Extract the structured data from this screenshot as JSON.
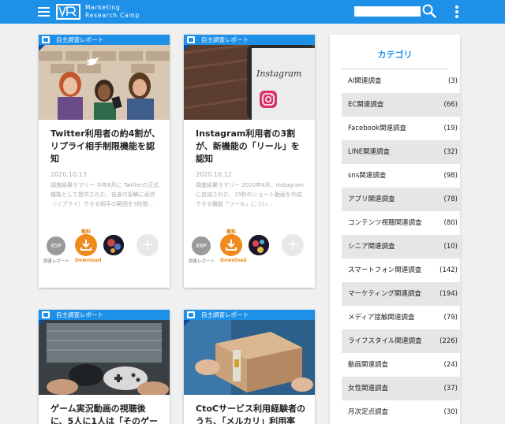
{
  "header": {
    "brand_line1": "Marketing",
    "brand_line2": "Research Camp",
    "search_placeholder": ""
  },
  "label_text": "自主調査レポート",
  "cards": [
    {
      "label": "自主調査レポート",
      "title": "Twitter利用者の約4割が、リプライ相手制限機能を認知",
      "date": "2020.10.13",
      "excerpt": "調査結果サマリー 今年8月に Twitterの正式機能として提供された、自身の投稿に返信（リプライ）できる相手の範囲を3段階…",
      "pages": "85P",
      "pages_caption": "調査レポート",
      "free": "無料",
      "download": "Download"
    },
    {
      "label": "自主調査レポート",
      "title": "Instagram利用者の3割が、新機能の「リール」を認知",
      "date": "2020.10.12",
      "excerpt": "調査結果サマリー 2020年8月、Instagramに追加された、15秒のショート動画を作成できる機能「リール」につい…",
      "pages": "88P",
      "pages_caption": "調査レポート",
      "free": "無料",
      "download": "Download"
    },
    {
      "label": "自主調査レポート",
      "title": "ゲーム実況動画の視聴後に、5人に1人は「そのゲー"
    },
    {
      "label": "自主調査レポート",
      "title": "CtoCサービス利用経験者のうち、「メルカリ」利用率"
    }
  ],
  "sidebar": {
    "title": "カテゴリ",
    "items": [
      {
        "name": "AI関連調査",
        "count": "(3)"
      },
      {
        "name": "EC関連調査",
        "count": "(66)"
      },
      {
        "name": "Facebook関連調査",
        "count": "(19)"
      },
      {
        "name": "LINE関連調査",
        "count": "(32)"
      },
      {
        "name": "sns関連調査",
        "count": "(98)"
      },
      {
        "name": "アプリ関連調査",
        "count": "(78)"
      },
      {
        "name": "コンテンツ視聴関連調査",
        "count": "(80)"
      },
      {
        "name": "シニア関連調査",
        "count": "(10)"
      },
      {
        "name": "スマートフォン関連調査",
        "count": "(142)"
      },
      {
        "name": "マーケティング関連調査",
        "count": "(194)"
      },
      {
        "name": "メディア接触関連調査",
        "count": "(79)"
      },
      {
        "name": "ライフスタイル関連調査",
        "count": "(226)"
      },
      {
        "name": "動画関連調査",
        "count": "(24)"
      },
      {
        "name": "女性関連調査",
        "count": "(37)"
      },
      {
        "name": "月次定点調査",
        "count": "(30)"
      }
    ]
  },
  "colors": {
    "primary": "#1e90e8",
    "download": "#f08a1c"
  }
}
